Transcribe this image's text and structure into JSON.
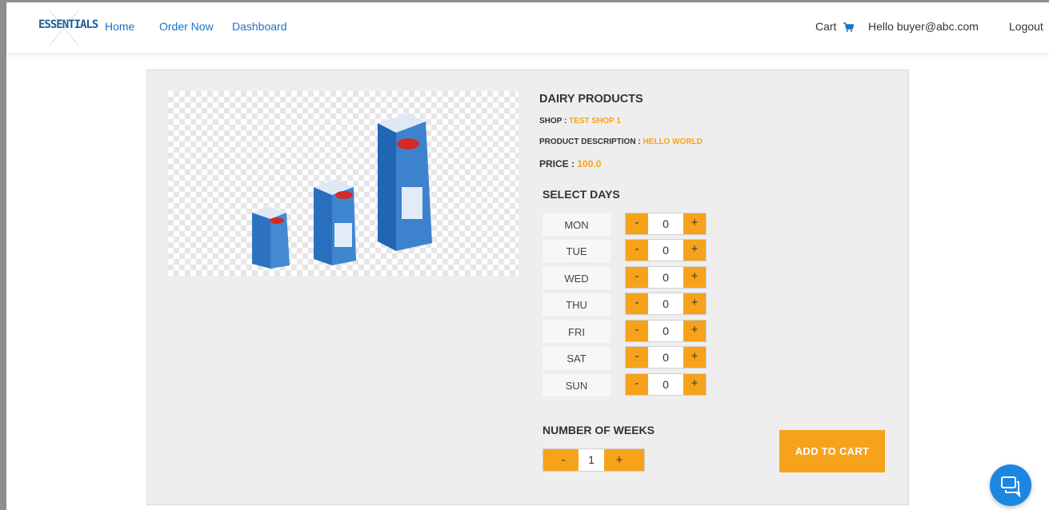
{
  "nav": {
    "logo": "ESSENTIALS",
    "links": [
      "Home",
      "Order Now",
      "Dashboard"
    ],
    "cart": "Cart",
    "greeting": "Hello buyer@abc.com",
    "logout": "Logout"
  },
  "product": {
    "title": "DAIRY PRODUCTS",
    "shop_label": "SHOP : ",
    "shop_value": "TEST SHOP 1",
    "desc_label": "PRODUCT DESCRIPTION : ",
    "desc_value": "HELLO WORLD",
    "price_label": "PRICE : ",
    "price_value": "100.0"
  },
  "select_days": {
    "title": "SELECT DAYS",
    "minus": "-",
    "plus": "+",
    "days": [
      {
        "label": "MON",
        "value": "0"
      },
      {
        "label": "TUE",
        "value": "0"
      },
      {
        "label": "WED",
        "value": "0"
      },
      {
        "label": "THU",
        "value": "0"
      },
      {
        "label": "FRI",
        "value": "0"
      },
      {
        "label": "SAT",
        "value": "0"
      },
      {
        "label": "SUN",
        "value": "0"
      }
    ]
  },
  "weeks": {
    "title": "NUMBER OF WEEKS",
    "minus": "-",
    "plus": "+",
    "value": "1"
  },
  "add_to_cart": "ADD TO CART",
  "colors": {
    "accent": "#f7a21b",
    "link": "#1a73c9",
    "chat": "#1d86e0"
  },
  "icons": {
    "cart": "shopping-cart-icon",
    "chat": "chat-icon"
  }
}
